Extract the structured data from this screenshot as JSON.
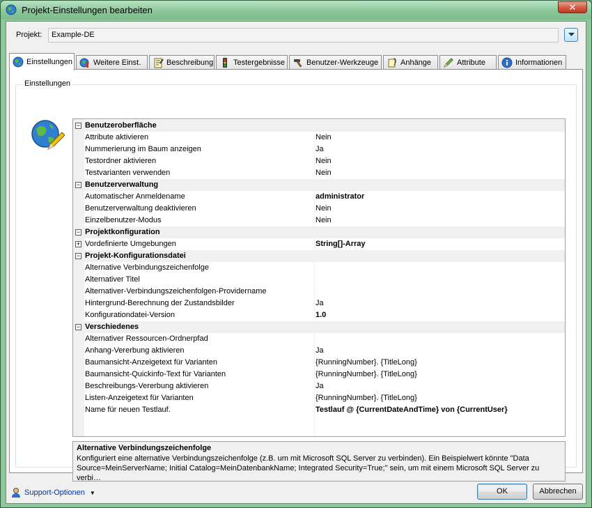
{
  "window": {
    "title": "Projekt-Einstellungen bearbeiten",
    "close_label": "✕"
  },
  "project": {
    "label": "Projekt:",
    "value": "Example-DE"
  },
  "tabs": [
    {
      "label": "Einstellungen",
      "icon": "globe-icon",
      "active": true
    },
    {
      "label": "Weitere Einst.",
      "icon": "globe-tools-icon"
    },
    {
      "label": "Beschreibung",
      "icon": "notepad-icon"
    },
    {
      "label": "Testergebnisse",
      "icon": "traffic-light-icon"
    },
    {
      "label": "Benutzer-Werkzeuge",
      "icon": "hammer-icon"
    },
    {
      "label": "Anhänge",
      "icon": "attachment-icon"
    },
    {
      "label": "Attribute",
      "icon": "pencil-icon"
    },
    {
      "label": "Informationen",
      "icon": "info-icon"
    }
  ],
  "group": {
    "label": "Einstellungen"
  },
  "properties": [
    {
      "type": "cat",
      "name": "Benutzeroberfläche"
    },
    {
      "name": "Attribute aktivieren",
      "value": "Nein"
    },
    {
      "name": "Nummerierung im Baum anzeigen",
      "value": "Ja"
    },
    {
      "name": "Testordner aktivieren",
      "value": "Nein"
    },
    {
      "name": "Testvarianten verwenden",
      "value": "Nein"
    },
    {
      "type": "cat",
      "name": "Benutzerverwaltung"
    },
    {
      "name": "Automatischer Anmeldename",
      "value": "administrator",
      "bold": true
    },
    {
      "name": "Benutzerverwaltung deaktivieren",
      "value": "Nein"
    },
    {
      "name": "Einzelbenutzer-Modus",
      "value": "Nein"
    },
    {
      "type": "cat",
      "name": "Projektkonfiguration"
    },
    {
      "name": "Vordefinierte Umgebungen",
      "value": "String[]-Array",
      "bold": true,
      "expandable": true
    },
    {
      "type": "cat",
      "name": "Projekt-Konfigurationsdatei"
    },
    {
      "name": "Alternative Verbindungszeichenfolge",
      "value": ""
    },
    {
      "name": "Alternativer Titel",
      "value": ""
    },
    {
      "name": "Alternativer-Verbindungszeichenfolgen-Providername",
      "value": ""
    },
    {
      "name": "Hintergrund-Berechnung der Zustandsbilder",
      "value": "Ja"
    },
    {
      "name": "Konfigurationdatei-Version",
      "value": "1.0",
      "bold": true
    },
    {
      "type": "cat",
      "name": "Verschiedenes"
    },
    {
      "name": "Alternativer Ressourcen-Ordnerpfad",
      "value": ""
    },
    {
      "name": "Anhang-Vererbung aktivieren",
      "value": "Ja"
    },
    {
      "name": "Baumansicht-Anzeigetext für Varianten",
      "value": "{RunningNumber}. {TitleLong}"
    },
    {
      "name": "Baumansicht-Quickinfo-Text für Varianten",
      "value": "{RunningNumber}. {TitleLong}"
    },
    {
      "name": "Beschreibungs-Vererbung aktivieren",
      "value": "Ja"
    },
    {
      "name": "Listen-Anzeigetext für Varianten",
      "value": "{RunningNumber}. {TitleLong}"
    },
    {
      "name": "Name für neuen Testlauf.",
      "value": "Testlauf @ {CurrentDateAndTime} von {CurrentUser}",
      "bold": true
    }
  ],
  "help": {
    "title": "Alternative Verbindungszeichenfolge",
    "text": "Konfiguriert eine alternative Verbindungszeichenfolge (z.B. um mit Microsoft SQL Server zu verbinden). Ein Beispielwert könnte \"Data Source=MeinServerName; Initial Catalog=MeinDatenbankName; Integrated Security=True;\" sein, um mit einem Microsoft SQL Server zu verbi…"
  },
  "footer": {
    "support_label": "Support-Optionen",
    "ok_label": "OK",
    "cancel_label": "Abbrechen"
  },
  "colors": {
    "frame": "#8fc79b",
    "dialog_bg": "#f0f0f0",
    "link": "#003399",
    "category_bg": "#f0f0f0"
  }
}
